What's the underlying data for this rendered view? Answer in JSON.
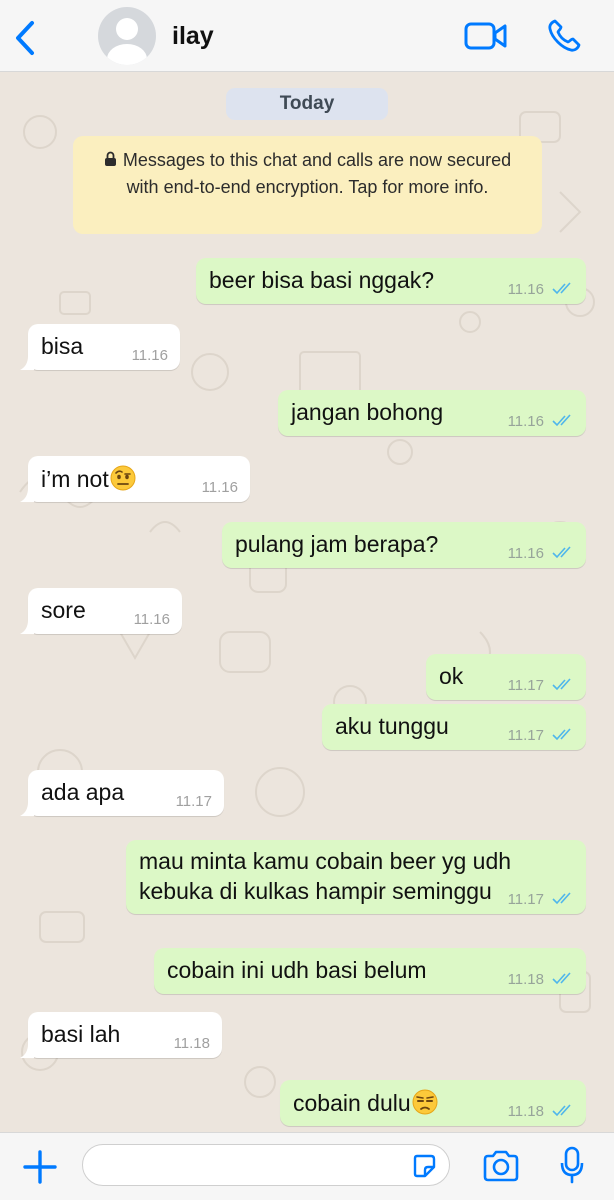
{
  "header": {
    "contact_name": "ilay",
    "icons": [
      "back-chevron-icon",
      "avatar-placeholder-icon",
      "video-call-icon",
      "phone-icon"
    ]
  },
  "chat": {
    "date_label": "Today",
    "encryption_notice": "Messages to this chat and calls are now secured with end-to-end encryption. Tap for more info.",
    "messages": [
      {
        "dir": "out",
        "text": "beer bisa basi nggak?",
        "time": "11.16",
        "read": true
      },
      {
        "dir": "in",
        "text": "bisa",
        "time": "11.16"
      },
      {
        "dir": "out",
        "text": "jangan bohong",
        "time": "11.16",
        "read": true
      },
      {
        "dir": "in",
        "text": "i’m not",
        "emoji": "face-with-raised-eyebrow",
        "time": "11.16"
      },
      {
        "dir": "out",
        "text": "pulang jam berapa?",
        "time": "11.16",
        "read": true
      },
      {
        "dir": "in",
        "text": "sore",
        "time": "11.16"
      },
      {
        "dir": "out",
        "text": "ok",
        "time": "11.17",
        "read": true
      },
      {
        "dir": "out",
        "text": "aku tunggu",
        "time": "11.17",
        "read": true
      },
      {
        "dir": "in",
        "text": "ada apa",
        "time": "11.17"
      },
      {
        "dir": "out",
        "text": "mau minta kamu cobain beer yg udh kebuka di kulkas hampir seminggu",
        "time": "11.17",
        "read": true
      },
      {
        "dir": "out",
        "text": "cobain ini udh basi belum",
        "time": "11.18",
        "read": true
      },
      {
        "dir": "in",
        "text": "basi lah",
        "time": "11.18"
      },
      {
        "dir": "out",
        "text": "cobain dulu",
        "emoji": "unamused-face",
        "time": "11.18",
        "read": true
      }
    ]
  },
  "input": {
    "placeholder": "",
    "value": "",
    "icons": [
      "plus-icon",
      "sticker-icon",
      "camera-icon",
      "microphone-icon"
    ]
  },
  "colors": {
    "accent": "#007aff",
    "outgoing_bubble": "#dcf8c6",
    "incoming_bubble": "#ffffff",
    "chat_background": "#ece5dd",
    "encryption_bg": "#fbefbf",
    "read_ticks": "#4fb6ec"
  }
}
